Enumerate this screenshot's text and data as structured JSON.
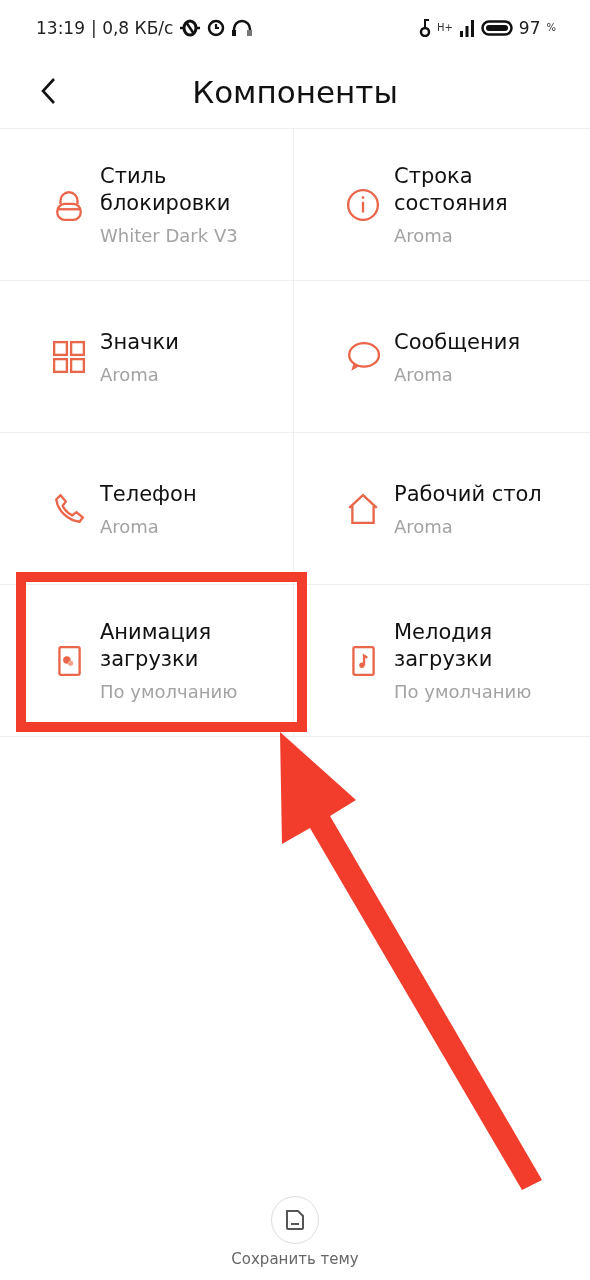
{
  "status_bar": {
    "time": "13:19",
    "speed": "| 0,8 КБ/с",
    "network": "H+",
    "battery": "97",
    "battery_unit": "%"
  },
  "header": {
    "title": "Компоненты"
  },
  "components": [
    {
      "kind": "lock",
      "title": "Стиль блокировки",
      "value": "Whiter Dark V3",
      "highlighted": false
    },
    {
      "kind": "info",
      "title": "Строка состояния",
      "value": "Aroma",
      "highlighted": false
    },
    {
      "kind": "grid",
      "title": "Значки",
      "value": "Aroma",
      "highlighted": false
    },
    {
      "kind": "chat",
      "title": "Сообщения",
      "value": "Aroma",
      "highlighted": false
    },
    {
      "kind": "phone",
      "title": "Телефон",
      "value": "Aroma",
      "highlighted": false
    },
    {
      "kind": "home",
      "title": "Рабочий стол",
      "value": "Aroma",
      "highlighted": false
    },
    {
      "kind": "animation",
      "title": "Анимация загрузки",
      "value": "По умолчанию",
      "highlighted": true
    },
    {
      "kind": "music",
      "title": "Мелодия загрузки",
      "value": "По умолчанию",
      "highlighted": false
    }
  ],
  "pointer_arrow": true,
  "save_button": {
    "label": "Сохранить тему"
  }
}
